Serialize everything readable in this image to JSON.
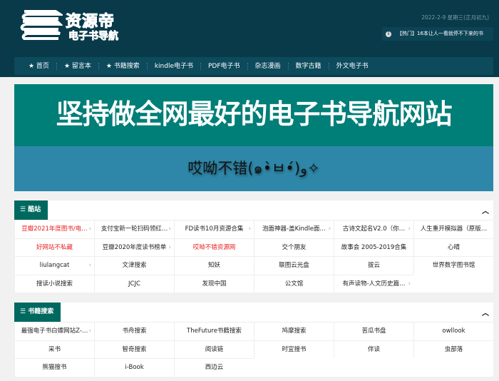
{
  "header": {
    "logo_title": "资源帝",
    "logo_subtitle": "电子书导航",
    "date": "2022-2-9 星期三(正月初九)",
    "hot_icon": "info-icon",
    "hot_text": "【热门】16本让人一看就停不下来的书"
  },
  "nav": [
    {
      "label": "★ 首页"
    },
    {
      "label": "★ 留言本"
    },
    {
      "label": "★ 书籍搜索"
    },
    {
      "label": "kindle电子书"
    },
    {
      "label": "PDF电子书"
    },
    {
      "label": "杂志漫画"
    },
    {
      "label": "数字古籍"
    },
    {
      "label": "外文电子书"
    }
  ],
  "banner": {
    "title": "坚持做全网最好的电子书导航网站",
    "subtitle": "哎呦不错(๑•̀ㅂ•́)و✧"
  },
  "sections": [
    {
      "title": "☰ 酷站",
      "items": [
        {
          "label": "豆瓣2021年度图书/电…",
          "red": true,
          "arrow": true
        },
        {
          "label": "支付宝新一轮扫码领红…",
          "arrow": true
        },
        {
          "label": "FD读书10月资源合集",
          "arrow": true
        },
        {
          "label": "泡面神器-盖Kindle面…",
          "arrow": true
        },
        {
          "label": "古诗文起名V2.0（你…",
          "arrow": true
        },
        {
          "label": "人生重开模拟器（原版…"
        },
        {
          "label": "好网站不私藏",
          "red": true
        },
        {
          "label": "豆瓣2020年度读书榜单",
          "arrow": true
        },
        {
          "label": "哎呦不错资源网",
          "red": true
        },
        {
          "label": "交个朋友"
        },
        {
          "label": "故事会 2005-2019合集"
        },
        {
          "label": "心晴"
        },
        {
          "label": "liulangcat",
          "arrow": true
        },
        {
          "label": "文津搜索"
        },
        {
          "label": "知妖"
        },
        {
          "label": "联图云光盘"
        },
        {
          "label": "拔云"
        },
        {
          "label": "世界数字图书馆"
        },
        {
          "label": "搜读小说搜索"
        },
        {
          "label": "JCJC"
        },
        {
          "label": "发现中国"
        },
        {
          "label": "公文馆"
        },
        {
          "label": "有声读物-人文历史篇…",
          "arrow": true
        }
      ]
    },
    {
      "title": "☰ 书籍搜索",
      "items": [
        {
          "label": "最强电子书白嫖网站Z-…",
          "arrow": true
        },
        {
          "label": "书舟搜索"
        },
        {
          "label": "TheFuture书籍搜索"
        },
        {
          "label": "鸠摩搜索"
        },
        {
          "label": "苦瓜书盘"
        },
        {
          "label": "owllook"
        },
        {
          "label": "采书"
        },
        {
          "label": "智奇搜索"
        },
        {
          "label": "阅读链"
        },
        {
          "label": "时宜搜书"
        },
        {
          "label": "伴读"
        },
        {
          "label": "虫部落"
        },
        {
          "label": "熊猫搜书"
        },
        {
          "label": "i-Book"
        },
        {
          "label": "西边云"
        }
      ]
    }
  ]
}
